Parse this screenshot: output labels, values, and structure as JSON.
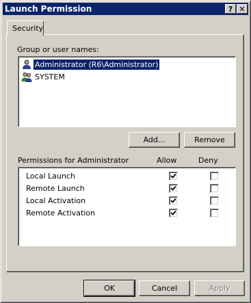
{
  "window": {
    "title": "Launch Permission",
    "help_button": "?",
    "close_button": "✕"
  },
  "tab": {
    "label": "Security"
  },
  "users": {
    "label": "Group or user names:",
    "items": [
      {
        "label": "Administrator (R6\\Administrator)",
        "icon": "user-icon",
        "selected": true
      },
      {
        "label": "SYSTEM",
        "icon": "group-icon",
        "selected": false
      }
    ]
  },
  "actions": {
    "add_label": "Add...",
    "remove_label": "Remove"
  },
  "permissions": {
    "header": "Permissions for Administrator",
    "allow_header": "Allow",
    "deny_header": "Deny",
    "rows": [
      {
        "label": "Local Launch",
        "allow": true,
        "deny": false
      },
      {
        "label": "Remote Launch",
        "allow": true,
        "deny": false
      },
      {
        "label": "Local Activation",
        "allow": true,
        "deny": false
      },
      {
        "label": "Remote Activation",
        "allow": true,
        "deny": false
      }
    ]
  },
  "footer": {
    "ok_label": "OK",
    "cancel_label": "Cancel",
    "apply_label": "Apply"
  },
  "colors": {
    "titlebar": "#0a246a",
    "face": "#d4d0c8",
    "selection": "#0a246a"
  }
}
